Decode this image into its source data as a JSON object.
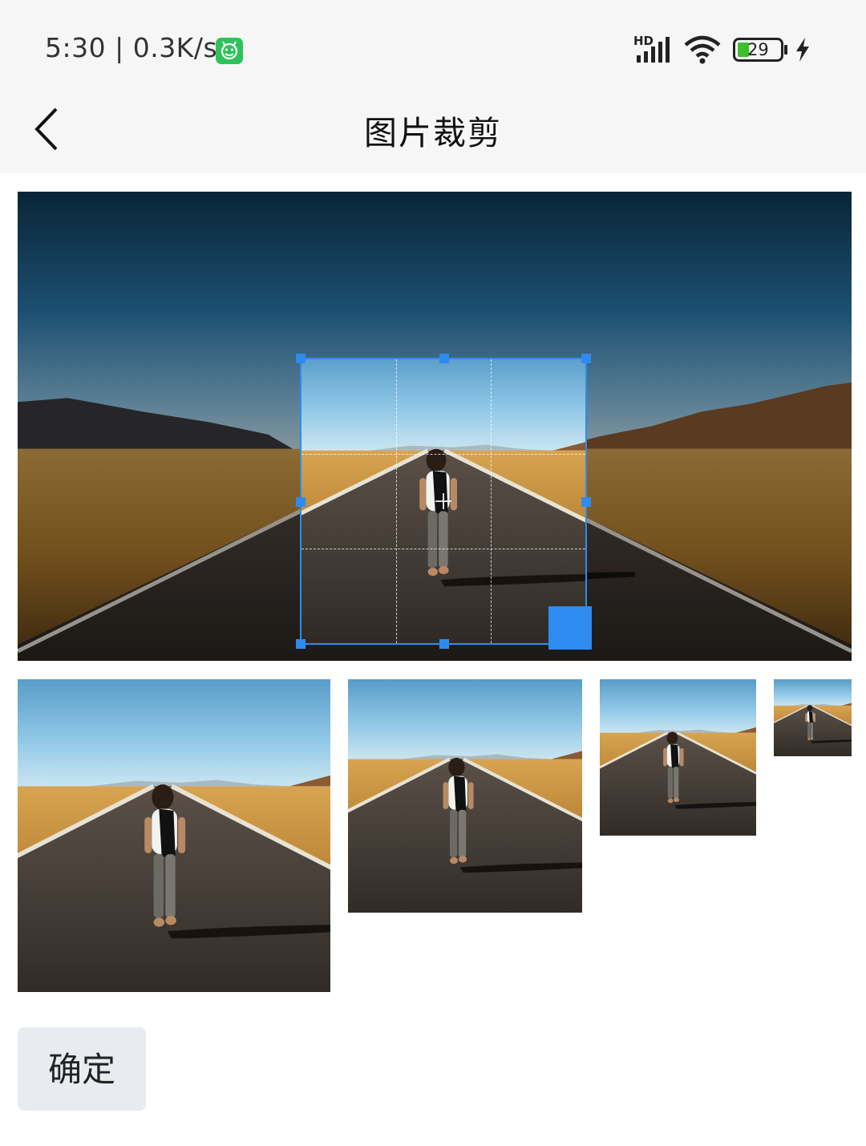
{
  "status_bar": {
    "time_speed": "5:30 | 0.3K/s",
    "network_label": "HD",
    "battery_level": "29"
  },
  "header": {
    "title": "图片裁剪"
  },
  "colors": {
    "accent": "#2e8cf0",
    "badge": "#2fc25b",
    "battery_fill": "#3cbf2e"
  },
  "actions": {
    "confirm_label": "确定"
  }
}
